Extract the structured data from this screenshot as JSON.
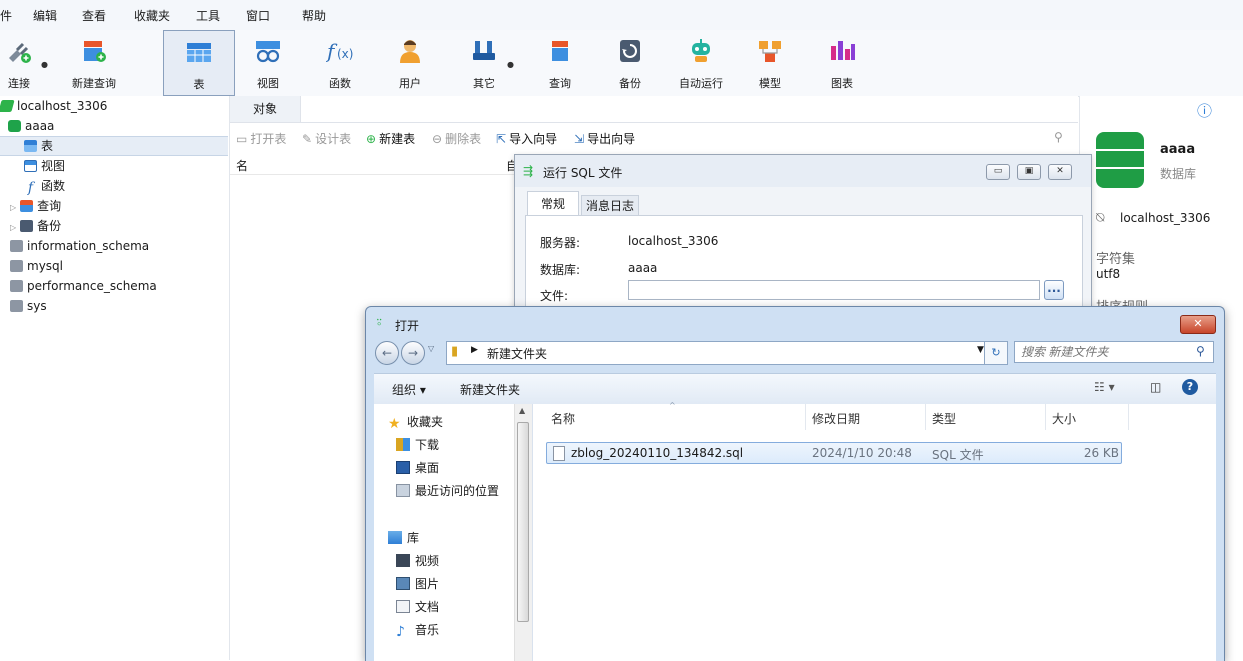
{
  "menu": [
    "件",
    "编辑",
    "查看",
    "收藏夹",
    "工具",
    "窗口",
    "帮助"
  ],
  "toolbar": {
    "connect": "连接",
    "new_query": "新建查询",
    "table": "表",
    "view": "视图",
    "function": "函数",
    "user": "用户",
    "other": "其它",
    "query": "查询",
    "backup": "备份",
    "automation": "自动运行",
    "model": "模型",
    "chart": "图表"
  },
  "tree": {
    "connection": "localhost_3306",
    "db": "aaaa",
    "children": [
      "表",
      "视图",
      "函数",
      "查询",
      "备份"
    ],
    "others": [
      "information_schema",
      "mysql",
      "performance_schema",
      "sys"
    ]
  },
  "center": {
    "tab": "对象",
    "open_table": "打开表",
    "design_table": "设计表",
    "new_table": "新建表",
    "delete_table": "删除表",
    "import_wizard": "导入向导",
    "export_wizard": "导出向导",
    "col_name": "名",
    "col_auto": "自"
  },
  "info": {
    "db_name": "aaaa",
    "db_type": "数据库",
    "connection": "localhost_3306",
    "charset_label": "字符集",
    "charset": "utf8",
    "collation_label": "排序规则"
  },
  "sql_dialog": {
    "title": "运行 SQL 文件",
    "tab_general": "常规",
    "tab_log": "消息日志",
    "server_label": "服务器:",
    "server": "localhost_3306",
    "database_label": "数据库:",
    "database": "aaaa",
    "file_label": "文件:",
    "file_value": "",
    "browse": "..."
  },
  "open_dialog": {
    "title": "打开",
    "path": "新建文件夹",
    "search_placeholder": "搜索 新建文件夹",
    "organize": "组织 ▾",
    "new_folder": "新建文件夹",
    "nav": {
      "favorites": "收藏夹",
      "downloads": "下载",
      "desktop": "桌面",
      "recent": "最近访问的位置",
      "libraries": "库",
      "videos": "视频",
      "pictures": "图片",
      "documents": "文档",
      "music": "音乐"
    },
    "columns": {
      "name": "名称",
      "modified": "修改日期",
      "type": "类型",
      "size": "大小"
    },
    "files": [
      {
        "name": "zblog_20240110_134842.sql",
        "modified": "2024/1/10 20:48",
        "type": "SQL 文件",
        "size": "26 KB"
      }
    ]
  }
}
